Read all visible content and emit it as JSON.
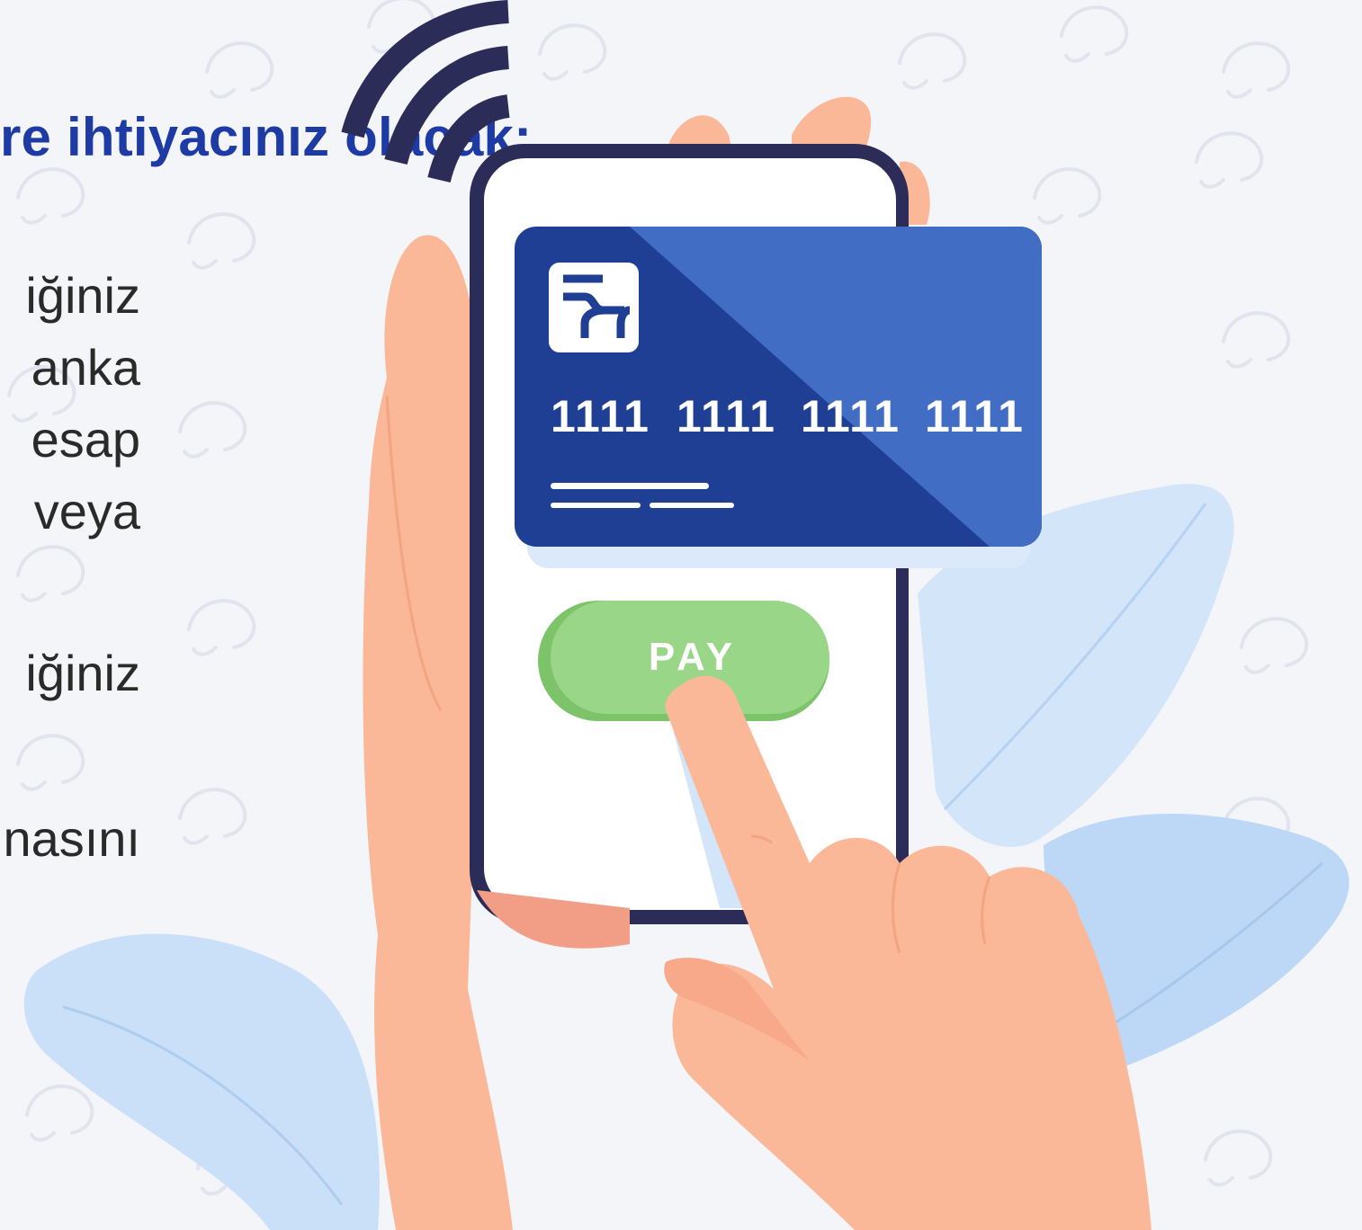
{
  "heading": "re ihtiyacınız olacak:",
  "lines": [
    "iğiniz",
    "anka",
    "esap",
    "veya",
    "iğiniz",
    "nasını"
  ],
  "card": {
    "number_groups": [
      "1111",
      "1111",
      "1111",
      "1111"
    ]
  },
  "pay_button": {
    "label": "PAY"
  },
  "colors": {
    "heading": "#1d3aa5",
    "card_dark": "#1e3f93",
    "card_light": "#416dc5",
    "pay_button": "#99d687",
    "skin": "#fbb898",
    "phone_frame": "#2b2c57",
    "leaf": "#c9e0f8"
  }
}
